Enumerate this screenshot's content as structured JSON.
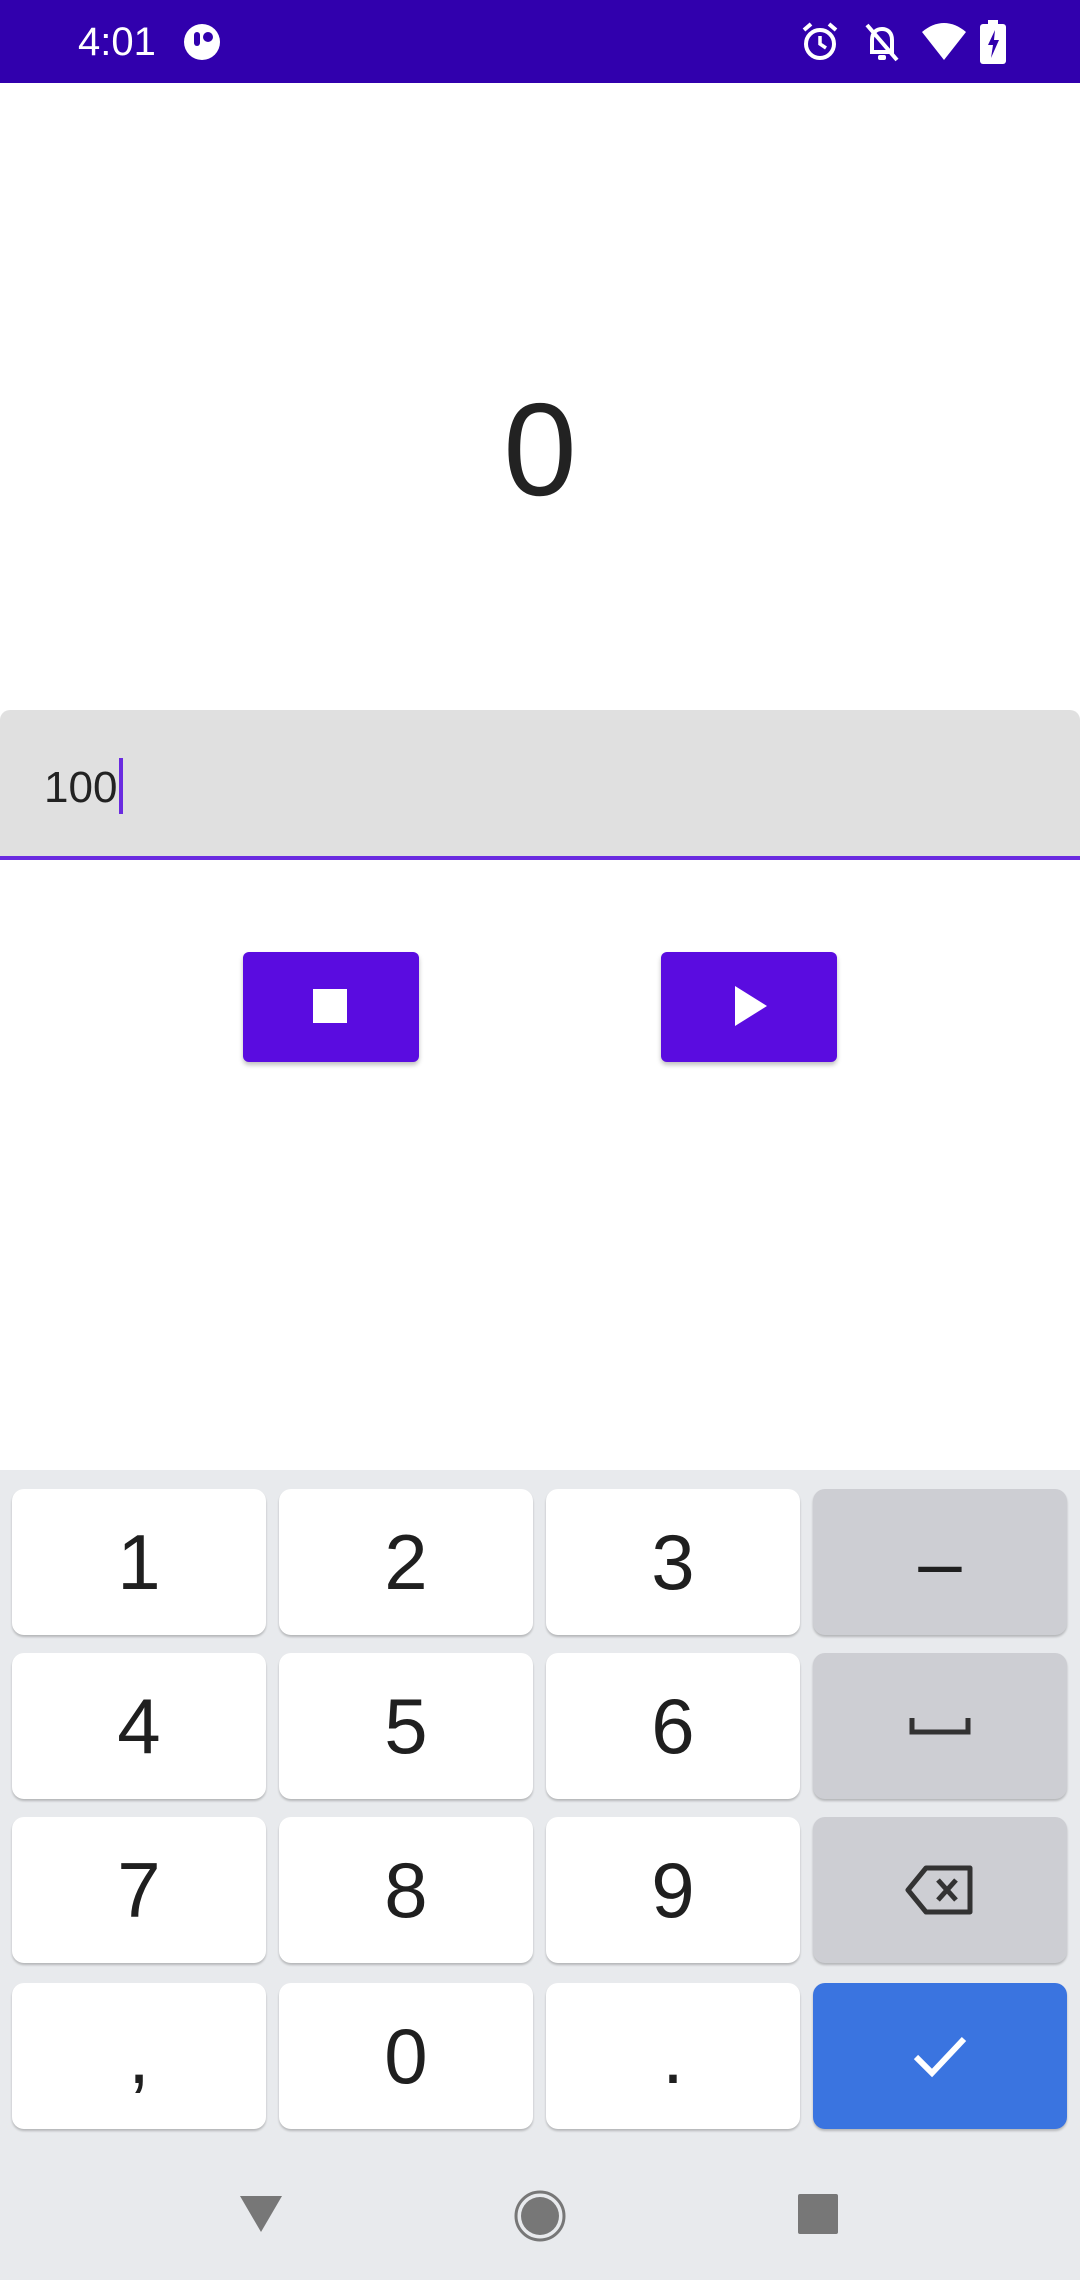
{
  "status_bar": {
    "time": "4:01",
    "background": "#3100AD",
    "icons": [
      "app-icon",
      "alarm-icon",
      "bell-off-icon",
      "wifi-icon",
      "battery-charging-icon"
    ]
  },
  "counter": {
    "value": "0"
  },
  "input": {
    "value": "100"
  },
  "buttons": {
    "stop": {
      "icon": "stop-icon"
    },
    "play": {
      "icon": "play-icon"
    },
    "color": "#5A0CE0"
  },
  "keyboard": {
    "rows": [
      [
        "1",
        "2",
        "3",
        "–"
      ],
      [
        "4",
        "5",
        "6",
        "space"
      ],
      [
        "7",
        "8",
        "9",
        "backspace"
      ],
      [
        ",",
        "0",
        ".",
        "done"
      ]
    ],
    "k1": "1",
    "k2": "2",
    "k3": "3",
    "kdash": "–",
    "k4": "4",
    "k5": "5",
    "k6": "6",
    "k7": "7",
    "k8": "8",
    "k9": "9",
    "kcomma": ",",
    "k0": "0",
    "kdot": ".",
    "done_color": "#3A74E0"
  },
  "nav_bar": {
    "icons": [
      "back-icon",
      "home-icon",
      "recents-icon"
    ]
  }
}
